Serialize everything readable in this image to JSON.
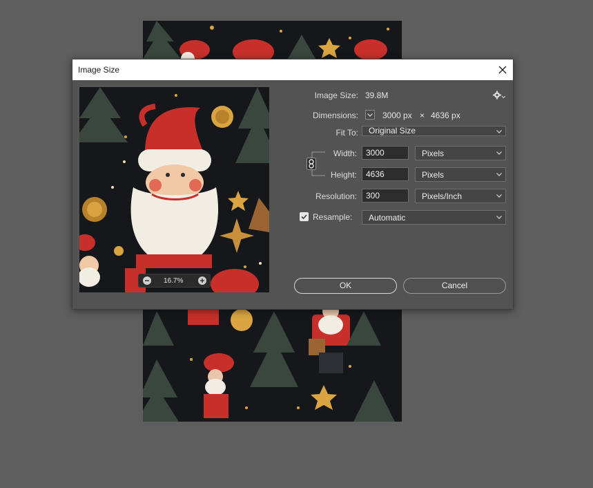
{
  "dialog": {
    "title": "Image Size",
    "image_size_label": "Image Size:",
    "image_size_value": "39.8M",
    "dimensions_label": "Dimensions:",
    "dimensions_width": "3000 px",
    "dimensions_x": "×",
    "dimensions_height": "4636 px",
    "fit_to_label": "Fit To:",
    "fit_to_value": "Original Size",
    "width_label": "Width:",
    "width_value": "3000",
    "width_unit": "Pixels",
    "height_label": "Height:",
    "height_value": "4636",
    "height_unit": "Pixels",
    "resolution_label": "Resolution:",
    "resolution_value": "300",
    "resolution_unit": "Pixels/Inch",
    "resample_label": "Resample:",
    "resample_checked": true,
    "resample_value": "Automatic",
    "ok_label": "OK",
    "cancel_label": "Cancel",
    "zoom_value": "16.7%"
  },
  "icons": {
    "close": "close-icon",
    "gear": "gear-icon",
    "link": "link-icon",
    "zoom_out": "zoom-out-icon",
    "zoom_in": "zoom-in-icon",
    "chevron": "chevron-down-icon",
    "check": "checkmark-icon"
  },
  "colors": {
    "workspace": "#5e5e5e",
    "dialog_bg": "#535353",
    "field_bg": "#2d2d2d",
    "santa_red": "#c7302a",
    "gold": "#d9a441",
    "tree_green": "#39473f",
    "night_bg": "#15171a"
  }
}
